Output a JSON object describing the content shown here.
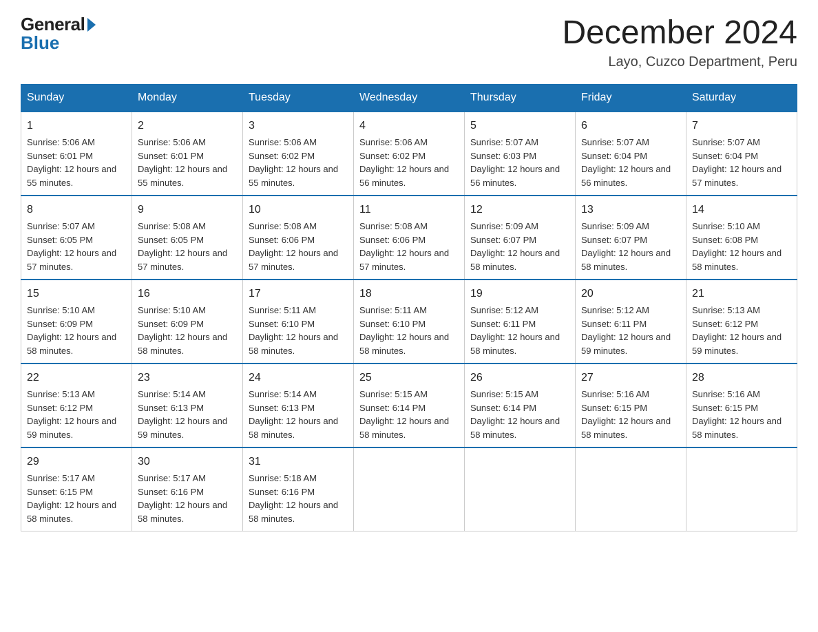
{
  "logo": {
    "general": "General",
    "blue": "Blue"
  },
  "header": {
    "title": "December 2024",
    "subtitle": "Layo, Cuzco Department, Peru"
  },
  "days": [
    "Sunday",
    "Monday",
    "Tuesday",
    "Wednesday",
    "Thursday",
    "Friday",
    "Saturday"
  ],
  "weeks": [
    [
      {
        "date": "1",
        "sunrise": "5:06 AM",
        "sunset": "6:01 PM",
        "daylight": "12 hours and 55 minutes."
      },
      {
        "date": "2",
        "sunrise": "5:06 AM",
        "sunset": "6:01 PM",
        "daylight": "12 hours and 55 minutes."
      },
      {
        "date": "3",
        "sunrise": "5:06 AM",
        "sunset": "6:02 PM",
        "daylight": "12 hours and 55 minutes."
      },
      {
        "date": "4",
        "sunrise": "5:06 AM",
        "sunset": "6:02 PM",
        "daylight": "12 hours and 56 minutes."
      },
      {
        "date": "5",
        "sunrise": "5:07 AM",
        "sunset": "6:03 PM",
        "daylight": "12 hours and 56 minutes."
      },
      {
        "date": "6",
        "sunrise": "5:07 AM",
        "sunset": "6:04 PM",
        "daylight": "12 hours and 56 minutes."
      },
      {
        "date": "7",
        "sunrise": "5:07 AM",
        "sunset": "6:04 PM",
        "daylight": "12 hours and 57 minutes."
      }
    ],
    [
      {
        "date": "8",
        "sunrise": "5:07 AM",
        "sunset": "6:05 PM",
        "daylight": "12 hours and 57 minutes."
      },
      {
        "date": "9",
        "sunrise": "5:08 AM",
        "sunset": "6:05 PM",
        "daylight": "12 hours and 57 minutes."
      },
      {
        "date": "10",
        "sunrise": "5:08 AM",
        "sunset": "6:06 PM",
        "daylight": "12 hours and 57 minutes."
      },
      {
        "date": "11",
        "sunrise": "5:08 AM",
        "sunset": "6:06 PM",
        "daylight": "12 hours and 57 minutes."
      },
      {
        "date": "12",
        "sunrise": "5:09 AM",
        "sunset": "6:07 PM",
        "daylight": "12 hours and 58 minutes."
      },
      {
        "date": "13",
        "sunrise": "5:09 AM",
        "sunset": "6:07 PM",
        "daylight": "12 hours and 58 minutes."
      },
      {
        "date": "14",
        "sunrise": "5:10 AM",
        "sunset": "6:08 PM",
        "daylight": "12 hours and 58 minutes."
      }
    ],
    [
      {
        "date": "15",
        "sunrise": "5:10 AM",
        "sunset": "6:09 PM",
        "daylight": "12 hours and 58 minutes."
      },
      {
        "date": "16",
        "sunrise": "5:10 AM",
        "sunset": "6:09 PM",
        "daylight": "12 hours and 58 minutes."
      },
      {
        "date": "17",
        "sunrise": "5:11 AM",
        "sunset": "6:10 PM",
        "daylight": "12 hours and 58 minutes."
      },
      {
        "date": "18",
        "sunrise": "5:11 AM",
        "sunset": "6:10 PM",
        "daylight": "12 hours and 58 minutes."
      },
      {
        "date": "19",
        "sunrise": "5:12 AM",
        "sunset": "6:11 PM",
        "daylight": "12 hours and 58 minutes."
      },
      {
        "date": "20",
        "sunrise": "5:12 AM",
        "sunset": "6:11 PM",
        "daylight": "12 hours and 59 minutes."
      },
      {
        "date": "21",
        "sunrise": "5:13 AM",
        "sunset": "6:12 PM",
        "daylight": "12 hours and 59 minutes."
      }
    ],
    [
      {
        "date": "22",
        "sunrise": "5:13 AM",
        "sunset": "6:12 PM",
        "daylight": "12 hours and 59 minutes."
      },
      {
        "date": "23",
        "sunrise": "5:14 AM",
        "sunset": "6:13 PM",
        "daylight": "12 hours and 59 minutes."
      },
      {
        "date": "24",
        "sunrise": "5:14 AM",
        "sunset": "6:13 PM",
        "daylight": "12 hours and 58 minutes."
      },
      {
        "date": "25",
        "sunrise": "5:15 AM",
        "sunset": "6:14 PM",
        "daylight": "12 hours and 58 minutes."
      },
      {
        "date": "26",
        "sunrise": "5:15 AM",
        "sunset": "6:14 PM",
        "daylight": "12 hours and 58 minutes."
      },
      {
        "date": "27",
        "sunrise": "5:16 AM",
        "sunset": "6:15 PM",
        "daylight": "12 hours and 58 minutes."
      },
      {
        "date": "28",
        "sunrise": "5:16 AM",
        "sunset": "6:15 PM",
        "daylight": "12 hours and 58 minutes."
      }
    ],
    [
      {
        "date": "29",
        "sunrise": "5:17 AM",
        "sunset": "6:15 PM",
        "daylight": "12 hours and 58 minutes."
      },
      {
        "date": "30",
        "sunrise": "5:17 AM",
        "sunset": "6:16 PM",
        "daylight": "12 hours and 58 minutes."
      },
      {
        "date": "31",
        "sunrise": "5:18 AM",
        "sunset": "6:16 PM",
        "daylight": "12 hours and 58 minutes."
      },
      null,
      null,
      null,
      null
    ]
  ]
}
